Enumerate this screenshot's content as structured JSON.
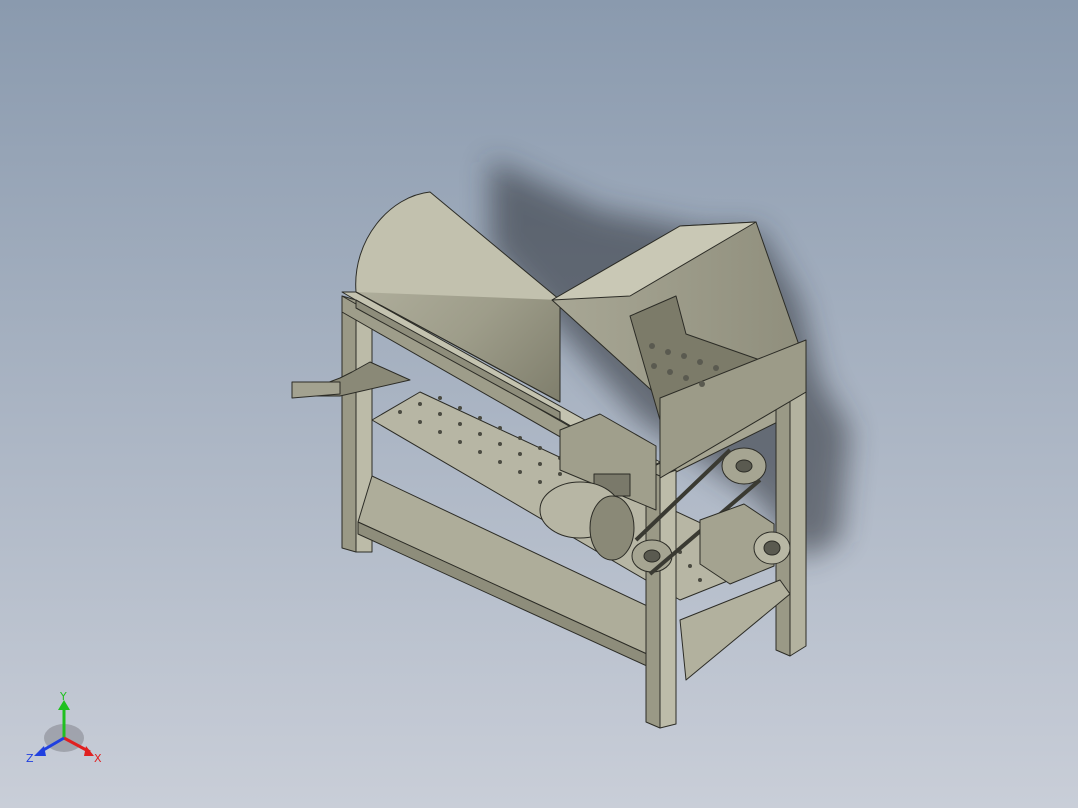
{
  "viewport": {
    "background_top": "#8d9cb0",
    "background_bottom": "#c7ccd6",
    "model_color": "#a9a895"
  },
  "triad": {
    "x_label": "X",
    "y_label": "Y",
    "z_label": "Z",
    "x_color": "#e02020",
    "y_color": "#20c020",
    "z_color": "#2040e0"
  }
}
